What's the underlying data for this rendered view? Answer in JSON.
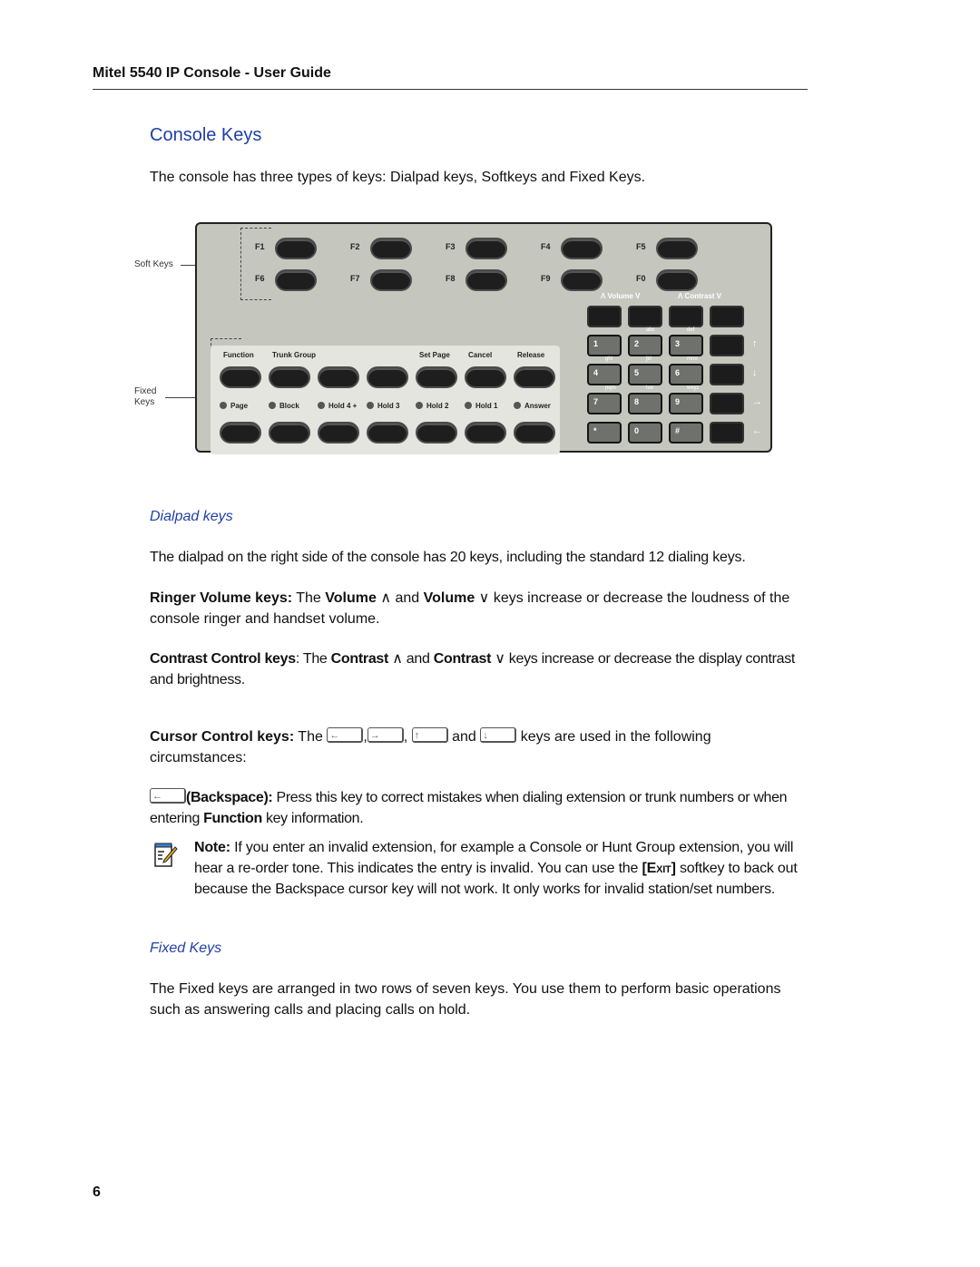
{
  "header": {
    "running_title": "Mitel 5540 IP Console - User Guide"
  },
  "section": {
    "title": "Console Keys",
    "intro": "The console has three types of keys: Dialpad keys, Softkeys and Fixed Keys."
  },
  "figure": {
    "callouts": {
      "soft_keys": "Soft Keys",
      "fixed_keys_line1": "Fixed",
      "fixed_keys_line2": "Keys"
    },
    "softkeys_row1": [
      "F1",
      "F2",
      "F3",
      "F4",
      "F5"
    ],
    "softkeys_row2": [
      "F6",
      "F7",
      "F8",
      "F9",
      "F0"
    ],
    "volume_label": "Λ Volume V",
    "contrast_label": "Λ Contrast V",
    "fixed_top_labels": [
      "Function",
      "Trunk Group",
      "",
      "",
      "Set Page",
      "Cancel",
      "Release"
    ],
    "fixed_bottom_labels": [
      "Page",
      "Block",
      "Hold 4 +",
      "Hold 3",
      "Hold 2",
      "Hold 1",
      "Answer"
    ],
    "dialpad": {
      "digits": [
        [
          "1",
          "2",
          "3"
        ],
        [
          "4",
          "5",
          "6"
        ],
        [
          "7",
          "8",
          "9"
        ],
        [
          "*",
          "0",
          "#"
        ]
      ],
      "letters": [
        [
          "",
          "abc",
          "def"
        ],
        [
          "ghi",
          "jkl",
          "mno"
        ],
        [
          "pqrs",
          "tuv",
          "wxyz"
        ]
      ],
      "arrows": [
        "↑",
        "↓",
        "→",
        "←"
      ]
    }
  },
  "dialpad_section": {
    "heading": "Dialpad keys",
    "p1": "The dialpad on the right side of the console has 20 keys, including the standard 12 dialing keys.",
    "ringer_bold": "Ringer Volume keys:",
    "ringer_t1": " The ",
    "ringer_b1": "Volume",
    "ringer_t2": " ∧ and ",
    "ringer_b2": "Volume",
    "ringer_t3": " ∨ keys increase or decrease the loudness of the console ringer and handset volume.",
    "contrast_bold": "Contrast Control keys",
    "contrast_t1": ": The ",
    "contrast_b1": "Contrast",
    "contrast_t2": " ∧ and ",
    "contrast_b2": "Contrast",
    "contrast_t3": " ∨ keys increase or decrease the display contrast and brightness.",
    "cursor_bold": "Cursor Control keys:",
    "cursor_t1": " The ",
    "cursor_icons": [
      "←",
      "→",
      "↑",
      "↓"
    ],
    "cursor_sep1": ",",
    "cursor_sep2": ", ",
    "cursor_and": " and ",
    "cursor_t2": " keys are used in the following circumstances:",
    "backspace_bold": "(Backspace):",
    "backspace_t1": " Press this key to correct mistakes when dialing extension or trunk numbers or when entering ",
    "backspace_b2": "Function",
    "backspace_t2": " key information.",
    "note_bold": "Note:",
    "note_t1": " If you enter an invalid extension, for example a Console or Hunt Group extension, you will hear a re-order tone. This indicates the entry is invalid. You can use the ",
    "note_exit": "[Exit]",
    "note_t2": " softkey to back out because the Backspace cursor key will not work. It only works for invalid station/set numbers."
  },
  "fixed_section": {
    "heading": "Fixed Keys",
    "p1": "The Fixed keys are arranged in two rows of seven keys. You use them to perform basic operations such as answering calls and placing calls on hold."
  },
  "footer": {
    "page_number": "6"
  }
}
